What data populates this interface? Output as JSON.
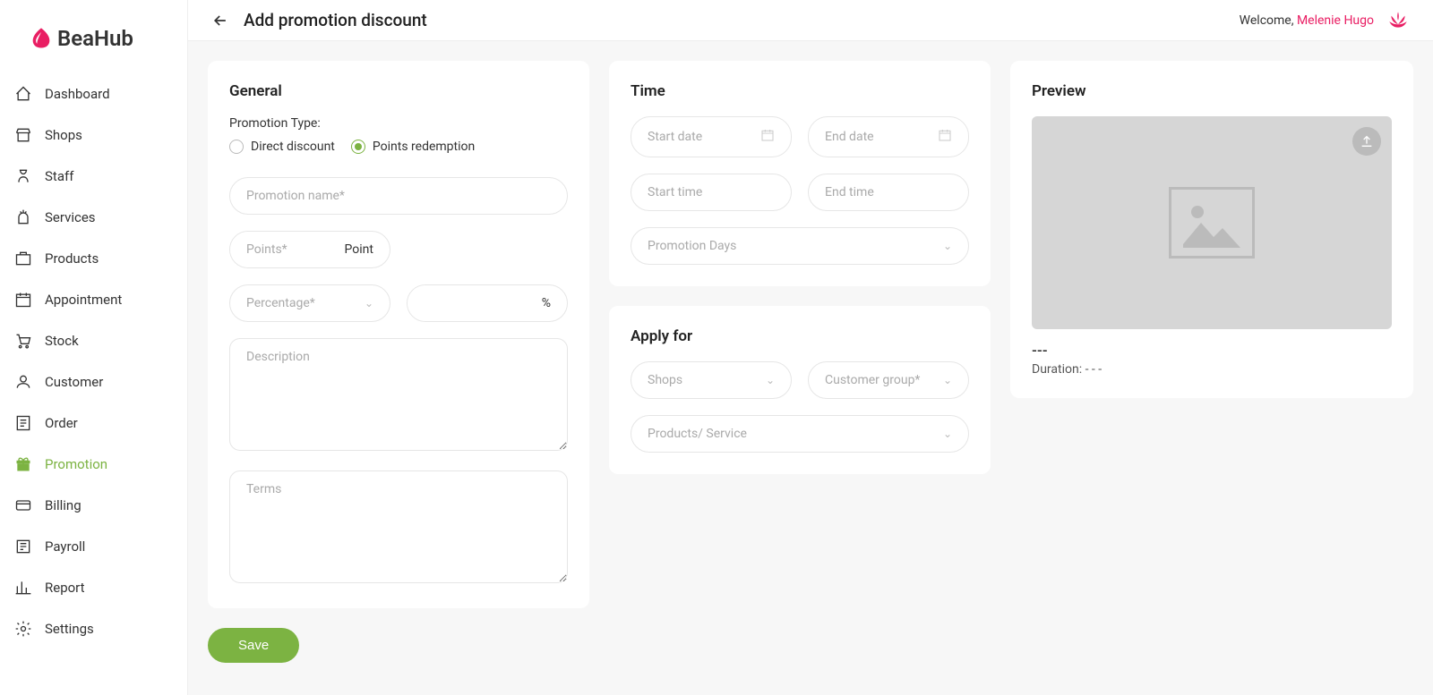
{
  "brand": {
    "name": "BeaHub"
  },
  "sidebar": {
    "items": [
      {
        "label": "Dashboard",
        "icon": "dashboard-icon"
      },
      {
        "label": "Shops",
        "icon": "shop-icon"
      },
      {
        "label": "Staff",
        "icon": "staff-icon"
      },
      {
        "label": "Services",
        "icon": "services-icon"
      },
      {
        "label": "Products",
        "icon": "products-icon"
      },
      {
        "label": "Appointment",
        "icon": "appointment-icon"
      },
      {
        "label": "Stock",
        "icon": "stock-icon"
      },
      {
        "label": "Customer",
        "icon": "customer-icon"
      },
      {
        "label": "Order",
        "icon": "order-icon"
      },
      {
        "label": "Promotion",
        "icon": "promotion-icon",
        "active": true
      },
      {
        "label": "Billing",
        "icon": "billing-icon"
      },
      {
        "label": "Payroll",
        "icon": "payroll-icon"
      },
      {
        "label": "Report",
        "icon": "report-icon"
      },
      {
        "label": "Settings",
        "icon": "settings-icon"
      }
    ]
  },
  "header": {
    "title": "Add promotion discount",
    "welcome_prefix": "Welcome, ",
    "username": "Melenie Hugo"
  },
  "general": {
    "heading": "General",
    "promo_type_label": "Promotion Type:",
    "radio_direct": "Direct discount",
    "radio_points": "Points redemption",
    "selected_type": "points",
    "promo_name_ph": "Promotion name*",
    "points_ph": "Points*",
    "points_suffix": "Point",
    "percentage_ph": "Percentage*",
    "percent_suffix": "%",
    "description_ph": "Description",
    "terms_ph": "Terms"
  },
  "time": {
    "heading": "Time",
    "start_date_ph": "Start date",
    "end_date_ph": "End date",
    "start_time_ph": "Start time",
    "end_time_ph": "End time",
    "promo_days_ph": "Promotion Days"
  },
  "apply": {
    "heading": "Apply for",
    "shops_ph": "Shops",
    "customer_group_ph": "Customer group*",
    "products_ph": "Products/ Service"
  },
  "preview": {
    "heading": "Preview",
    "title": "---",
    "duration_label": "Duration: ",
    "duration_value": "- - -"
  },
  "actions": {
    "save": "Save"
  }
}
